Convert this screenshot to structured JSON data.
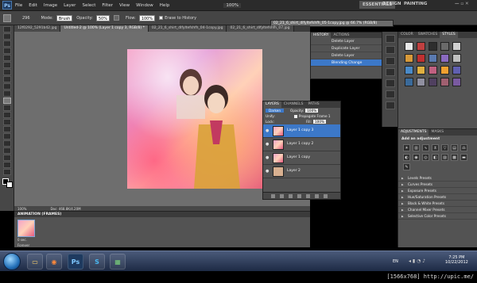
{
  "menubar": {
    "app_logo": "Ps",
    "items": [
      "File",
      "Edit",
      "Image",
      "Layer",
      "Select",
      "Filter",
      "View",
      "Window",
      "Help"
    ],
    "zoom": "100%",
    "workspaces": [
      "ESSENTIALS",
      "DESIGN",
      "PAINTING"
    ]
  },
  "options": {
    "brush_size": "296",
    "mode_label": "Mode:",
    "mode_value": "Brush",
    "opacity_label": "Opacity:",
    "opacity_value": "50%",
    "flow_label": "Flow:",
    "flow_value": "100%",
    "erase_history_label": "Erase to History"
  },
  "floating_doc_title": "02_21_6_shirt_dlfyltefshfh_05-1copy.jpg @ 66.7% (RGB/8)",
  "tabs": [
    "12f0292_5291b42.jpg",
    "Untitled-2 @ 100% (Layer 1 copy 3, RGB/8) *",
    "02_21_6_shirt_dlfyltefshfh_04-1copy.jpg",
    "02_21_6_shirt_dlfyltefshfh_07.jpg"
  ],
  "status": {
    "zoom": "100%",
    "doc": "Doc: 468.8K/4.20M"
  },
  "animation": {
    "title": "ANIMATION (FRAMES)",
    "frame_delay": "0 sec.",
    "loop": "Forever"
  },
  "history": {
    "tabs": [
      "HISTORY",
      "ACTIONS"
    ],
    "items": [
      {
        "label": "Delete Layer",
        "selected": false
      },
      {
        "label": "Duplicate Layer",
        "selected": false
      },
      {
        "label": "Delete Layer",
        "selected": false
      },
      {
        "label": "Blending Change",
        "selected": true
      }
    ]
  },
  "styles_panel": {
    "tabs": [
      "COLOR",
      "SWATCHES",
      "STYLES"
    ],
    "swatch_colors": [
      "#e9e9e9",
      "#c04040",
      "#2e2e2e",
      "#6a6a6a",
      "#d0d0d0",
      "#d89a3a",
      "#c03030",
      "#5a7ab0",
      "#8a6ac0",
      "#c0c0c0",
      "#4a8ac8",
      "#e0b040",
      "#c06080",
      "#f0a030",
      "#6060b0",
      "#3a6a9a",
      "#9090a0",
      "#504060",
      "#a06070",
      "#7a5aa0"
    ]
  },
  "adjustments": {
    "tabs": [
      "ADJUSTMENTS",
      "MASKS"
    ],
    "subtitle": "Add an adjustment",
    "presets": [
      "Levels Presets",
      "Curves Presets",
      "Exposure Presets",
      "Hue/Saturation Presets",
      "Black & White Presets",
      "Channel Mixer Presets",
      "Selective Color Presets"
    ]
  },
  "layers": {
    "tabs": [
      "LAYERS",
      "CHANNELS",
      "PATHS"
    ],
    "blend_mode": "Darken",
    "opacity_label": "Opacity:",
    "opacity_value": "100%",
    "unify_label": "Unify:",
    "propagate_label": "Propagate Frame 1",
    "lock_label": "Lock:",
    "fill_label": "Fill:",
    "fill_value": "100%",
    "items": [
      {
        "name": "Layer 1 copy 3",
        "selected": true
      },
      {
        "name": "Layer 1 copy 2",
        "selected": false
      },
      {
        "name": "Layer 1 copy",
        "selected": false
      },
      {
        "name": "Layer 2",
        "selected": false
      }
    ]
  },
  "taskbar": {
    "language": "EN",
    "time": "7:25 PM",
    "date": "10/22/2012"
  },
  "credit": "[1566x768] http://upic.me/"
}
